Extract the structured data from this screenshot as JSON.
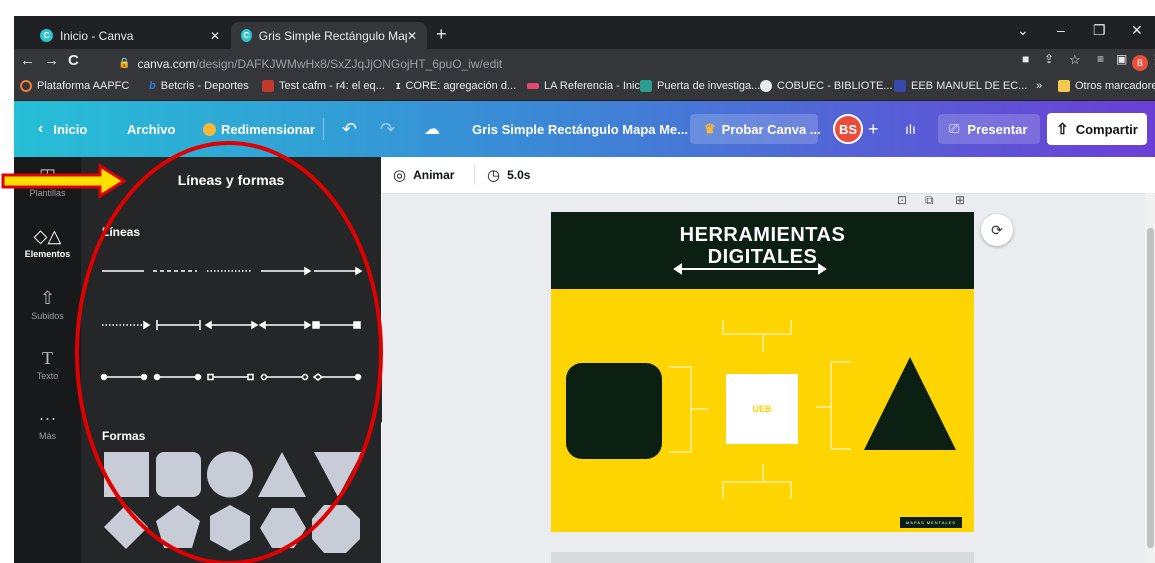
{
  "browser": {
    "tabs": [
      {
        "title": "Inicio - Canva"
      },
      {
        "title": "Gris Simple Rectángulo Mapa Me"
      }
    ],
    "url_host": "canva.com",
    "url_path": "/design/DAFKJWMwHx8/SxZJqJjONGojHT_6puO_iw/edit",
    "bookmarks": [
      "Plataforma AAPFC",
      "Betcris - Deportes",
      "Test cafm - r4: el eq...",
      "CORE: agregación d...",
      "LA Referencia - Inicio",
      "Puerta de investiga...",
      "COBUEC - BIBLIOTE...",
      "EEB MANUEL DE EC...",
      "»",
      "Otros marcadores"
    ],
    "profile_initial": "B"
  },
  "header": {
    "inicio": "Inicio",
    "archivo": "Archivo",
    "redimensionar": "Redimensionar",
    "design_title": "Gris Simple Rectángulo Mapa Me...",
    "probar": "Probar Canva ...",
    "avatar": "BS",
    "presentar": "Presentar",
    "compartir": "Compartir"
  },
  "rail": {
    "items": [
      "Plantillas",
      "Elementos",
      "Subidos",
      "Texto",
      "Más"
    ]
  },
  "panel": {
    "title": "Líneas y formas",
    "lineas": "Líneas",
    "formas": "Formas"
  },
  "toolbar": {
    "animar": "Animar",
    "duration": "5.0s"
  },
  "slide": {
    "title_line1": "HERRAMIENTAS",
    "title_line2": "DIGITALES",
    "center_label": "UEB",
    "badge": "MAPAS MENTALES"
  },
  "colors": {
    "slide_yellow": "#fed401",
    "slide_dark": "#0b1f13",
    "annotation_red": "#e00000",
    "arrow_yellow": "#ffe000"
  }
}
